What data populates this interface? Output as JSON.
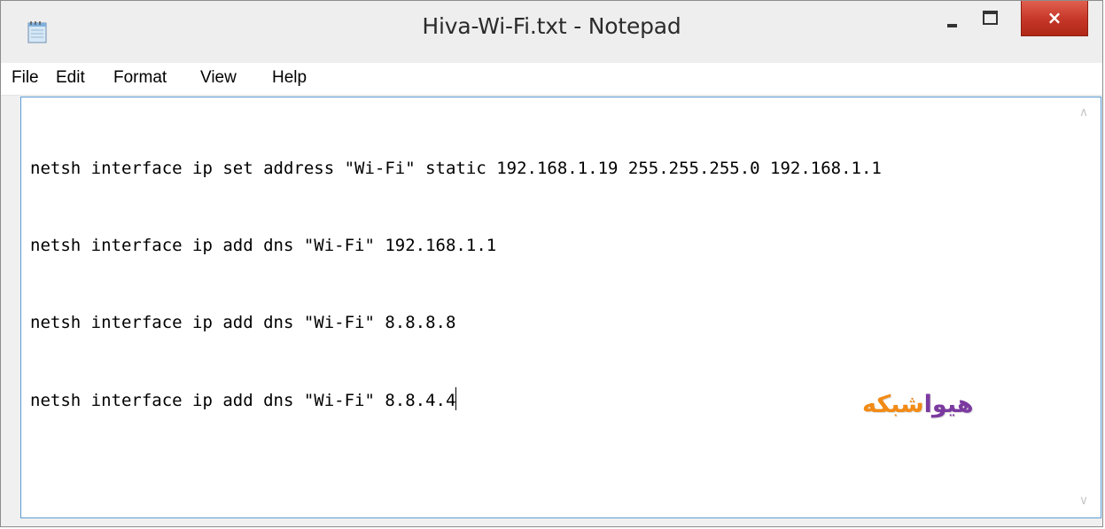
{
  "window": {
    "title": "Hiva-Wi-Fi.txt - Notepad",
    "icon": "notepad-icon",
    "controls": {
      "minimize": "minimize-icon",
      "maximize": "maximize-icon",
      "close": "×"
    }
  },
  "menu": {
    "items": [
      "File",
      "Edit",
      "Format",
      "View",
      "Help"
    ]
  },
  "editor": {
    "lines": [
      "netsh interface ip set address \"Wi-Fi\" static 192.168.1.19 255.255.255.0 192.168.1.1",
      "netsh interface ip add dns \"Wi-Fi\" 192.168.1.1",
      "netsh interface ip add dns \"Wi-Fi\" 8.8.8.8",
      "netsh interface ip add dns \"Wi-Fi\" 8.8.4.4"
    ]
  },
  "watermark": {
    "part1": "هیوا",
    "part2": "شبکه"
  },
  "colors": {
    "close_button": "#c7392a",
    "editor_border": "#5b9bd5",
    "watermark_purple": "#7b3aa0",
    "watermark_orange": "#f28b16"
  }
}
